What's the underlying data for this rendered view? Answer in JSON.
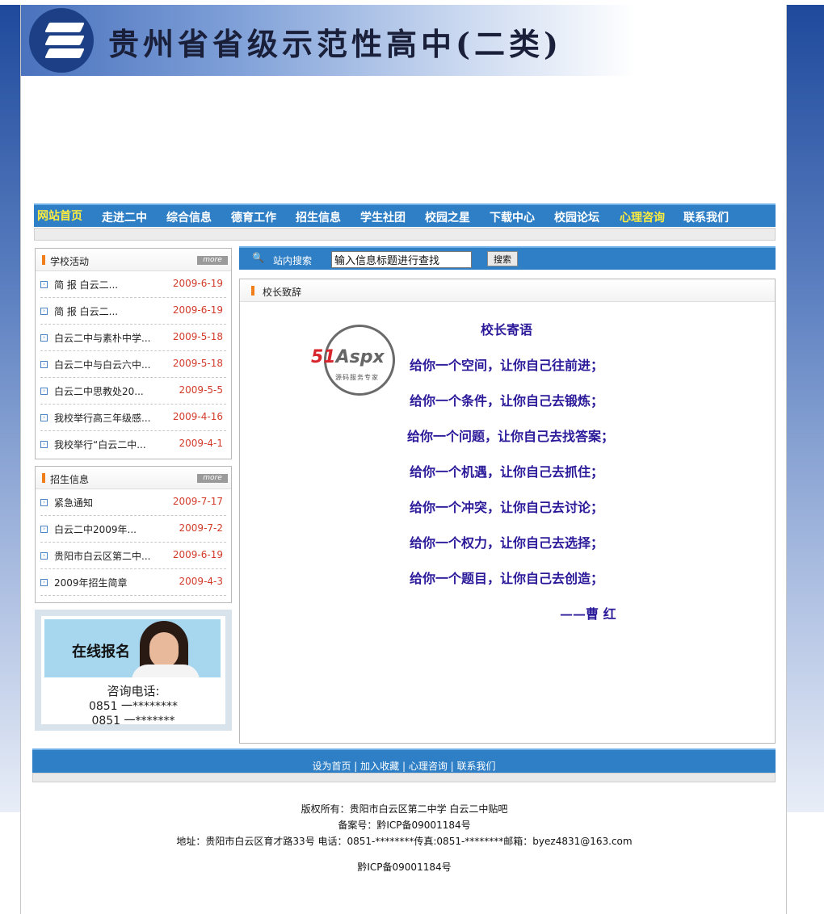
{
  "header": {
    "site_title": "贵州省省级示范性高中(二类)"
  },
  "nav": {
    "items": [
      {
        "label": "网站首页",
        "highlight": true
      },
      {
        "label": "走进二中"
      },
      {
        "label": "综合信息"
      },
      {
        "label": "德育工作"
      },
      {
        "label": "招生信息"
      },
      {
        "label": "学生社团"
      },
      {
        "label": "校园之星"
      },
      {
        "label": "下载中心"
      },
      {
        "label": "校园论坛"
      },
      {
        "label": "心理咨询",
        "highlight": true
      },
      {
        "label": "联系我们"
      }
    ]
  },
  "activities": {
    "title": "学校活动",
    "more": "more",
    "items": [
      {
        "text": "简 报 白云二...",
        "date": "2009-6-19"
      },
      {
        "text": "简 报 白云二...",
        "date": "2009-6-19"
      },
      {
        "text": "白云二中与素朴中学...",
        "date": "2009-5-18"
      },
      {
        "text": "白云二中与白云六中...",
        "date": "2009-5-18"
      },
      {
        "text": "白云二中思教处20...",
        "date": "2009-5-5"
      },
      {
        "text": "我校举行高三年级感...",
        "date": "2009-4-16"
      },
      {
        "text": "我校举行“白云二中...",
        "date": "2009-4-1"
      }
    ]
  },
  "admissions": {
    "title": "招生信息",
    "more": "more",
    "items": [
      {
        "text": "紧急通知",
        "date": "2009-7-17"
      },
      {
        "text": "白云二中2009年...",
        "date": "2009-7-2"
      },
      {
        "text": "贵阳市白云区第二中...",
        "date": "2009-6-19"
      },
      {
        "text": "2009年招生简章",
        "date": "2009-4-3"
      }
    ]
  },
  "signup": {
    "label": "在线报名",
    "consult": "咨询电话:",
    "phone1": "0851 一********",
    "phone2": "0851 一*******"
  },
  "search": {
    "label": "站内搜索",
    "value": "输入信息标题进行查找",
    "button": "搜索"
  },
  "principal": {
    "box_title": "校长致辞",
    "heading": "校长寄语",
    "lines": [
      "给你一个空间，让你自己往前进；",
      "给你一个条件，让你自己去锻炼；",
      "给你一个问题，让你自己去找答案；",
      "给你一个机遇，让你自己去抓住；",
      "给你一个冲突，让你自己去讨论；",
      "给你一个权力，让你自己去选择；",
      "给你一个题目，让你自己去创造；"
    ],
    "signature": "——曹 红"
  },
  "watermark": {
    "brand_red": "51",
    "brand_grey": "Aspx",
    "sub": "源码服务专家"
  },
  "footer": {
    "links": "设为首页 | 加入收藏 | 心理咨询 | 联系我们",
    "copyright": "版权所有：贵阳市白云区第二中学 白云二中贴吧",
    "icp": "备案号：黔ICP备09001184号",
    "address": "地址：贵阳市白云区育才路33号 电话：0851-********传真:0851-********邮箱：byez4831@163.com",
    "icp2": "黔ICP备09001184号"
  },
  "colors": {
    "nav_blue": "#2f7fc6",
    "date_red": "#d23b2a",
    "verse_blue": "#2a1a9a",
    "highlight_yellow": "#ffec3d"
  }
}
